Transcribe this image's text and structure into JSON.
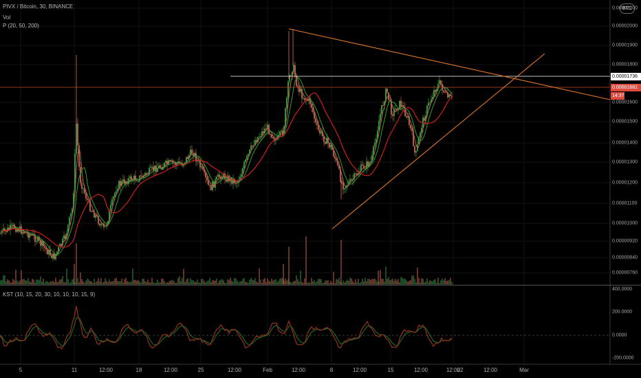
{
  "legend": {
    "symbol": "PIVX / Bitcoin, 30, BINANCE",
    "vol": "Vol",
    "ma": "P (20, 50, 200)",
    "kst": "KST (10, 15, 20, 30, 10, 10, 10, 15, 9)"
  },
  "currency_badge": "BTC",
  "price_axis": [
    "0.00002100",
    "0.00002000",
    "0.00001900",
    "0.00001800",
    "0.00001600",
    "0.00001500",
    "0.00001400",
    "0.00001300",
    "0.00001200",
    "0.00001100",
    "0.00001000",
    "0.00000920",
    "0.00000840",
    "0.00000760"
  ],
  "price_tags": {
    "level_line": "0.00001736",
    "last_price": "0.00001681",
    "countdown": "14:37"
  },
  "kst_axis": [
    "400.0000",
    "200.0000",
    "0.0000",
    "-200.0000"
  ],
  "time_axis": [
    "5",
    "11",
    "12:00",
    "18",
    "12:00",
    "25",
    "12:00",
    "Feb",
    "12:00",
    "8",
    "12:00",
    "15",
    "12:00",
    "12:00",
    "22",
    "12:00",
    "Mar"
  ],
  "colors": {
    "background": "#000000",
    "candle_up": "#4caf50",
    "candle_down": "#d6735c",
    "ma_fast": "#a86a4a",
    "ma_mid": "#2e9d3a",
    "ma_slow": "#cc2020",
    "trendline": "#e0782a",
    "level_line": "#ffffff",
    "last_price_line": "#c04a2c",
    "kst_line": "#8b2f1c",
    "kst_signal": "#1e7a28"
  }
}
